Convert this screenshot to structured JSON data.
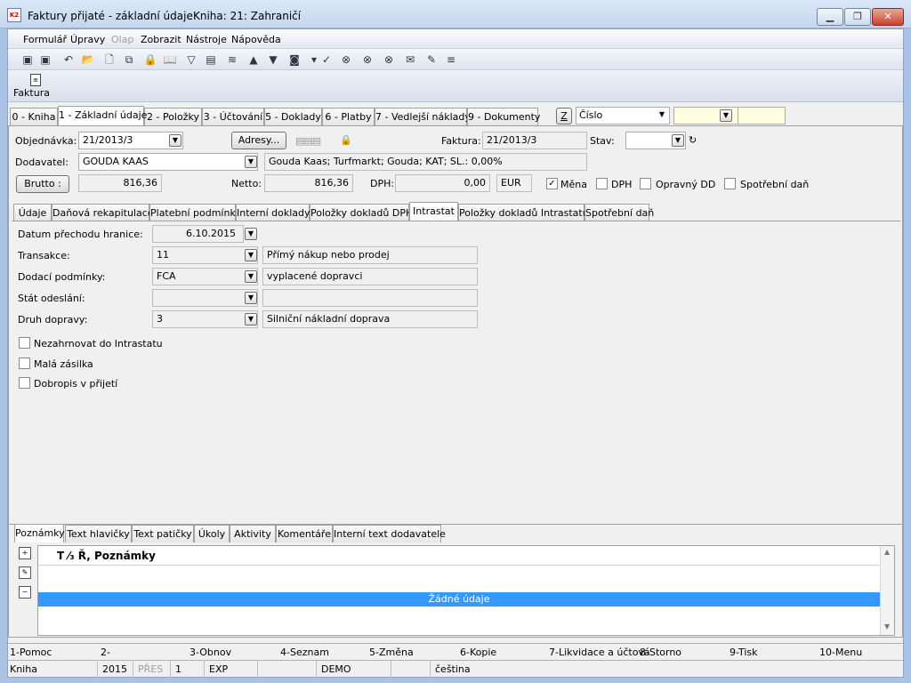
{
  "window": {
    "title": "Faktury přijaté - základní údaje",
    "book": "Kniha: 21: Zahraničí",
    "app_icon": "K2",
    "controls": {
      "minimize": "▁",
      "maximize": "❐",
      "close": "✕"
    }
  },
  "menu": [
    "Formulář",
    "Úpravy",
    "Olap",
    "Zobrazit",
    "Nástroje",
    "Nápověda"
  ],
  "menu_disabled": [
    false,
    false,
    true,
    false,
    false,
    false
  ],
  "toolbar_icons": [
    "save-icon",
    "save-as-icon",
    "undo-icon",
    "open-folder-icon",
    "new-document-icon",
    "copy-icon",
    "lock-icon",
    "book-icon",
    "filter-icon",
    "filter-list-icon",
    "stack-icon",
    "arrow-up-icon",
    "arrow-down-icon",
    "camera-icon",
    "dropdown-arrow-icon",
    "check-arrow-icon",
    "binoculars-icon",
    "binoculars-next-icon",
    "binoculars-all-icon",
    "mail-icon",
    "notes-icon",
    "menu-lines-icon"
  ],
  "toolbar_glyphs": [
    "▣",
    "▣",
    "↶",
    "📂",
    "🗋",
    "⧉",
    "🔒",
    "📖",
    "▽",
    "▤",
    "≋",
    "▲",
    "▼",
    "◙",
    "▾",
    "✓",
    "⊗",
    "⊗",
    "⊗",
    "✉",
    "✎",
    "≡"
  ],
  "faktura_button": "Faktura",
  "main_tabs": [
    "0 - Kniha",
    "1 - Základní údaje",
    "2 - Položky",
    "3 - Účtování",
    "5 - Doklady",
    "6 - Platby",
    "7 - Vedlejší náklady",
    "9 - Dokumenty"
  ],
  "right_controls": {
    "z_button": "Z",
    "sort_field": "Číslo"
  },
  "header": {
    "objednavka_label": "Objednávka:",
    "objednavka": "21/2013/3",
    "adresy_button": "Adresy...",
    "faktura_label": "Faktura:",
    "faktura": "21/2013/3",
    "stav_label": "Stav:",
    "stav": "",
    "dodavatel_label": "Dodavatel:",
    "dodavatel": "GOUDA KAAS",
    "dodavatel_info": "Gouda Kaas; Turfmarkt; Gouda; KAT; SL.: 0,00%",
    "brutto_button": "Brutto :",
    "brutto": "816,36",
    "netto_label": "Netto:",
    "netto": "816,36",
    "dph_label": "DPH:",
    "dph": "0,00",
    "currency": "EUR",
    "checks": [
      {
        "label": "Měna",
        "checked": true
      },
      {
        "label": "DPH",
        "checked": false
      },
      {
        "label": "Opravný DD",
        "checked": false
      },
      {
        "label": "Spotřební daň",
        "checked": false
      }
    ]
  },
  "sub_tabs": [
    "Údaje",
    "Daňová rekapitulace",
    "Platební podmínky",
    "Interní doklady",
    "Položky dokladů DPH",
    "Intrastat",
    "Položky dokladů Intrastatu",
    "Spotřební daň"
  ],
  "intrastat": {
    "datum_label": "Datum přechodu hranice:",
    "datum": "6.10.2015",
    "transakce_label": "Transakce:",
    "transakce": "11",
    "transakce_desc": "Přímý nákup nebo prodej",
    "dodaci_label": "Dodací podmínky:",
    "dodaci": "FCA",
    "dodaci_desc": "vyplacené dopravci",
    "stat_label": "Stát odeslání:",
    "stat": "",
    "stat_desc": "",
    "druh_label": "Druh dopravy:",
    "druh": "3",
    "druh_desc": "Silniční nákladní doprava",
    "checks": [
      {
        "label": "Nezahrnovat do Intrastatu",
        "checked": false
      },
      {
        "label": "Malá zásilka",
        "checked": false
      },
      {
        "label": "Dobropis v přijetí",
        "checked": false
      }
    ]
  },
  "notes_tabs": [
    "Poznámky",
    "Text hlavičky",
    "Text patičky",
    "Úkoly",
    "Aktivity",
    "Komentáře",
    "Interní text dodavatele"
  ],
  "notes_grid": {
    "header": "T ⁄₃ Ř, Poznámky",
    "empty": "Žádné údaje"
  },
  "fkeys": [
    "1-Pomoc",
    "2-",
    "3-Obnov",
    "4-Seznam",
    "5-Změna",
    "6-Kopie",
    "7-Likvidace a účtová",
    "8-Storno",
    "9-Tisk",
    "10-Menu"
  ],
  "status": [
    "Kniha",
    "2015",
    "PŘES",
    "1",
    "EXP",
    "",
    "DEMO",
    "",
    "čeština"
  ]
}
